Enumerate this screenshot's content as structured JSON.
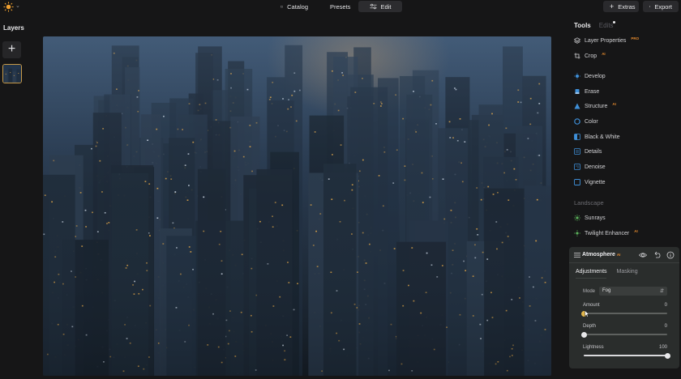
{
  "topbar": {
    "tabs": [
      {
        "label": "Catalog",
        "icon": "folder-icon",
        "active": false
      },
      {
        "label": "Presets",
        "icon": "sparkle-icon",
        "active": false
      },
      {
        "label": "Edit",
        "icon": "sliders-icon",
        "active": true
      }
    ],
    "extras_label": "Extras",
    "export_label": "Export"
  },
  "layers": {
    "title": "Layers",
    "add_icon": "plus-icon"
  },
  "panel": {
    "tab_tools": "Tools",
    "tab_edits": "Edits",
    "tools": [
      {
        "label": "Layer Properties",
        "icon": "layers-icon",
        "pro": "PRO"
      },
      {
        "label": "Crop",
        "icon": "crop-icon",
        "pro": "AI"
      },
      {
        "label": "Develop",
        "icon": "sun-icon",
        "pro": ""
      },
      {
        "label": "Erase",
        "icon": "eraser-icon",
        "pro": ""
      },
      {
        "label": "Structure",
        "icon": "structure-icon",
        "pro": "AI"
      },
      {
        "label": "Color",
        "icon": "color-icon",
        "pro": ""
      },
      {
        "label": "Black & White",
        "icon": "bw-icon",
        "pro": ""
      },
      {
        "label": "Details",
        "icon": "details-icon",
        "pro": ""
      },
      {
        "label": "Denoise",
        "icon": "denoise-icon",
        "pro": ""
      },
      {
        "label": "Vignette",
        "icon": "vignette-icon",
        "pro": ""
      }
    ],
    "landscape_label": "Landscape",
    "landscape_tools": [
      {
        "label": "Sunrays",
        "icon": "sunrays-icon",
        "pro": ""
      },
      {
        "label": "Twilight Enhancer",
        "icon": "twilight-icon",
        "pro": "AI"
      }
    ]
  },
  "atmosphere": {
    "title": "Atmosphere",
    "pro": "AI",
    "subtabs": [
      "Adjustments",
      "Masking"
    ],
    "mode_label": "Mode",
    "mode_value": "Fog",
    "sliders": [
      {
        "label": "Amount",
        "value": "0",
        "level": 0.0,
        "active": true
      },
      {
        "label": "Depth",
        "value": "0",
        "level": 0.0,
        "active": false
      },
      {
        "label": "Lightness",
        "value": "100",
        "level": 1.0,
        "active": false
      }
    ]
  },
  "colors": {
    "accent_orange": "#e58a2e",
    "active_knob": "#e0b54a",
    "tool_icon_blue": "#3e8fd8",
    "tool_icon_green": "#5ab05a"
  }
}
